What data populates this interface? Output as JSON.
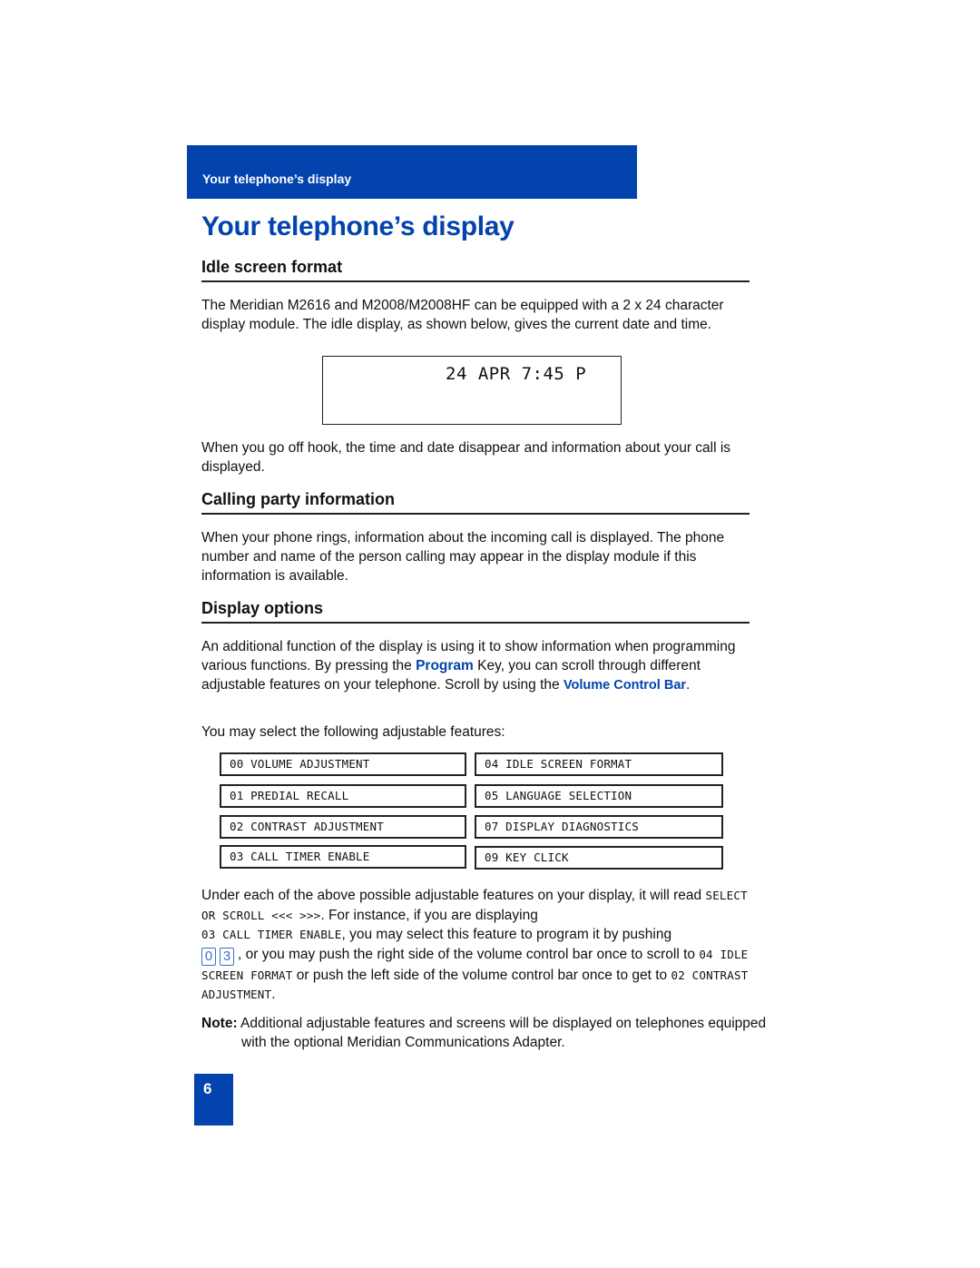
{
  "header": {
    "tab_label": "Your telephone’s display"
  },
  "page_title": "Your telephone’s display",
  "sections": {
    "idle": {
      "heading": "Idle screen format",
      "para1": "The Meridian M2616 and M2008/M2008HF can be equipped with a  2 x 24 character display module.  The idle display, as shown below, gives the current date and time.",
      "lcd_text": "24 APR 7:45 P",
      "para2": "When you go off hook, the time and date disappear and information about your call is displayed."
    },
    "calling": {
      "heading": "Calling party information",
      "para": "When your phone rings, information about the incoming call is displayed.  The phone number and name of the person calling may appear in the display module if this information is available."
    },
    "options": {
      "heading": "Display options",
      "para_a": "An additional function of the display is using it to show information when programming various functions.  By pressing the ",
      "program_key": "Program",
      "para_b": " Key, you can scroll through different adjustable features on your telephone.  Scroll by using the ",
      "volume_bar": "Volume Control Bar",
      "para_c": ".",
      "select_intro": "You may select the following adjustable features:",
      "features": [
        "00 VOLUME ADJUSTMENT",
        "01 PREDIAL RECALL",
        "02 CONTRAST ADJUSTMENT",
        "03 CALL TIMER ENABLE",
        "04 IDLE SCREEN FORMAT",
        "05 LANGUAGE SELECTION",
        "07 DISPLAY DIAGNOSTICS",
        "09 KEY CLICK"
      ],
      "explain": {
        "t1": "Under each of the above possible adjustable features on your display, it will read ",
        "m1": "SELECT OR SCROLL <<<  >>>",
        "t2": ".  For instance, if you are displaying ",
        "m2": "03 CALL TIMER ENABLE",
        "t3": ", you may select this feature to program it by pushing ",
        "key1": "0",
        "key2": "3",
        "t4": ", or you may push the right side of the volume control bar once to scroll to ",
        "m3": "04 IDLE SCREEN FORMAT",
        "t5": " or push the left side of the volume control bar once to get to ",
        "m4": "02 CONTRAST ADJUSTMENT",
        "t6": "."
      },
      "note_label": "Note:",
      "note_text": " Additional adjustable features and screens will be displayed on telephones equipped with the optional Meridian Communications Adapter."
    }
  },
  "page_number": "6",
  "colors": {
    "brand_blue": "#0343ad"
  }
}
